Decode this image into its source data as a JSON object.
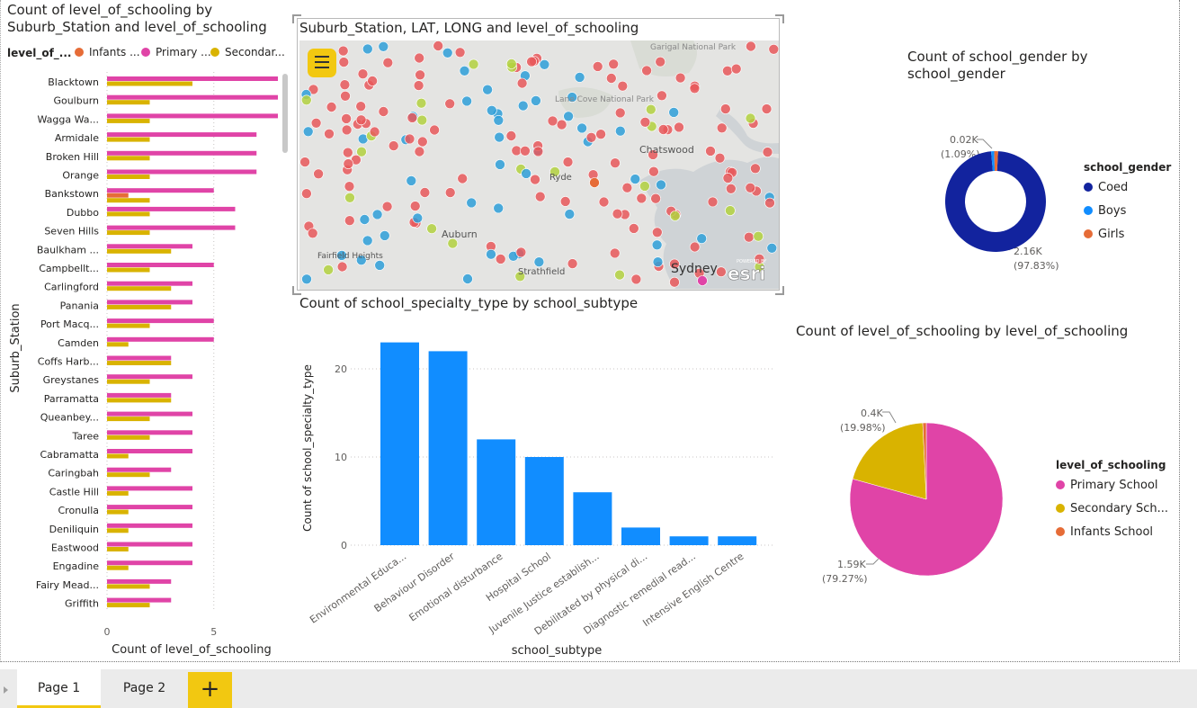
{
  "visuals": {
    "bar_suburb": {
      "title_line1": "Count of level_of_schooling by",
      "title_line2": "Suburb_Station and level_of_schooling",
      "legend_title": "level_of_...",
      "legend_items": [
        "Infants ...",
        "Primary ...",
        "Secondar..."
      ],
      "ylabel": "Suburb_Station",
      "xlabel": "Count of level_of_schooling",
      "xticks": [
        "0",
        "5"
      ]
    },
    "map": {
      "title": "Suburb_Station, LAT, LONG and level_of_schooling",
      "places": [
        "Garigal National Park",
        "Lane Cove National Park",
        "Chatswood",
        "Ryde",
        "Auburn",
        "Fairfield Heights",
        "Strathfield",
        "Sydney"
      ],
      "brand": "esri",
      "powered_by": "POWERED BY"
    },
    "column_subtype": {
      "title": "Count of school_specialty_type by school_subtype",
      "ylabel": "Count of school_specialty_type",
      "xlabel": "school_subtype",
      "yticks": [
        "0",
        "10",
        "20"
      ]
    },
    "donut_gender": {
      "title_line1": "Count of school_gender by",
      "title_line2": "school_gender",
      "legend_title": "school_gender",
      "label_small_value": "0.02K",
      "label_small_pct": "(1.09%)",
      "label_big_value": "2.16K",
      "label_big_pct": "(97.83%)"
    },
    "pie_level": {
      "title": "Count of level_of_schooling by level_of_schooling",
      "legend_title": "level_of_schooling",
      "label_primary_value": "1.59K",
      "label_primary_pct": "(79.27%)",
      "label_secondary_value": "0.4K",
      "label_secondary_pct": "(19.98%)"
    }
  },
  "colors": {
    "infants": "#e66c37",
    "primary": "#e044a7",
    "secondary": "#d9b300",
    "blue": "#118dff",
    "navy": "#12239e",
    "tab_accent": "#f2c811",
    "map_red": "#e8585a",
    "map_blue": "#2e9fd8",
    "map_green": "#b3d13f"
  },
  "chart_data": [
    {
      "type": "bar",
      "orientation": "horizontal",
      "categories": [
        "Blacktown",
        "Goulburn",
        "Wagga Wa...",
        "Armidale",
        "Broken Hill",
        "Orange",
        "Bankstown",
        "Dubbo",
        "Seven Hills",
        "Baulkham ...",
        "Campbellt...",
        "Carlingford",
        "Panania",
        "Port Macq...",
        "Camden",
        "Coffs Harb...",
        "Greystanes",
        "Parramatta",
        "Queanbey...",
        "Taree",
        "Cabramatta",
        "Caringbah",
        "Castle Hill",
        "Cronulla",
        "Deniliquin",
        "Eastwood",
        "Engadine",
        "Fairy Mead...",
        "Griffith"
      ],
      "series": [
        {
          "name": "Infants ...",
          "values": [
            0,
            0,
            0,
            0,
            0,
            0,
            1,
            0,
            0,
            0,
            0,
            0,
            0,
            0,
            0,
            0,
            0,
            0,
            0,
            0,
            0,
            0,
            0,
            0,
            0,
            0,
            0,
            0,
            0
          ]
        },
        {
          "name": "Primary ...",
          "values": [
            8,
            8,
            8,
            7,
            7,
            7,
            5,
            6,
            6,
            4,
            5,
            4,
            4,
            5,
            5,
            3,
            4,
            3,
            4,
            4,
            4,
            3,
            4,
            4,
            4,
            4,
            4,
            3,
            3
          ]
        },
        {
          "name": "Secondar...",
          "values": [
            4,
            2,
            2,
            2,
            2,
            2,
            2,
            2,
            2,
            3,
            2,
            3,
            3,
            2,
            1,
            3,
            2,
            3,
            2,
            2,
            1,
            2,
            1,
            1,
            1,
            1,
            1,
            2,
            2
          ]
        }
      ],
      "xlabel": "Count of level_of_schooling",
      "ylabel": "Suburb_Station",
      "xlim": [
        0,
        8
      ]
    },
    {
      "type": "bar",
      "categories": [
        "Environmental Educa...",
        "Behaviour Disorder",
        "Emotional disturbance",
        "Hospital School",
        "Juvenile Justice establish...",
        "Debilitated by physical di...",
        "Diagnostic remedial read...",
        "Intensive English Centre"
      ],
      "values": [
        23,
        22,
        12,
        10,
        6,
        2,
        1,
        1
      ],
      "xlabel": "school_subtype",
      "ylabel": "Count of school_specialty_type",
      "ylim": [
        0,
        23
      ]
    },
    {
      "type": "pie",
      "subtype": "donut",
      "labels": [
        "Coed",
        "Boys",
        "Girls"
      ],
      "values": [
        2160,
        22,
        27
      ],
      "colors": [
        "#12239e",
        "#118dff",
        "#e66c37"
      ]
    },
    {
      "type": "pie",
      "labels": [
        "Primary School",
        "Secondary Sch...",
        "Infants School"
      ],
      "values": [
        1590,
        400,
        15
      ],
      "colors": [
        "#e044a7",
        "#d9b300",
        "#e66c37"
      ]
    }
  ],
  "tabs": [
    {
      "label": "Page 1",
      "active": true
    },
    {
      "label": "Page 2",
      "active": false
    }
  ],
  "add_page_label": "+"
}
